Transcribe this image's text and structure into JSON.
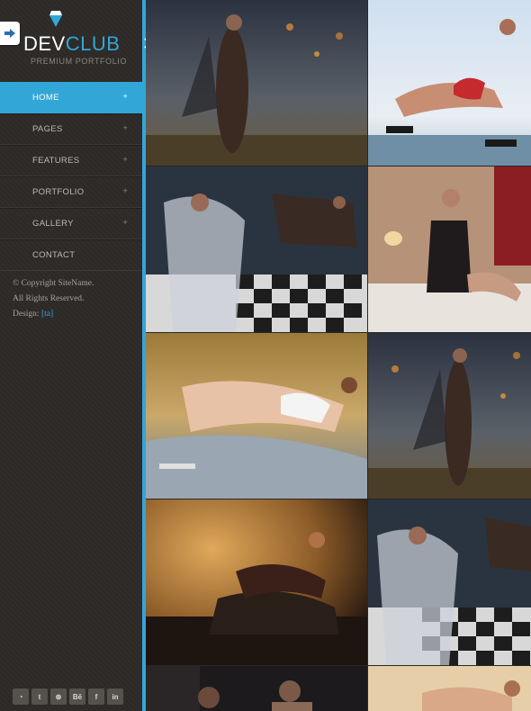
{
  "brand": {
    "title_part1": "DEV",
    "title_part2": "CLUB",
    "subtitle": "PREMIUM PORTFOLIO"
  },
  "nav": {
    "items": [
      {
        "label": "HOME",
        "has_sub": true
      },
      {
        "label": "PAGES",
        "has_sub": true
      },
      {
        "label": "FEATURES",
        "has_sub": true
      },
      {
        "label": "PORTFOLIO",
        "has_sub": true
      },
      {
        "label": "GALLERY",
        "has_sub": true
      },
      {
        "label": "CONTACT",
        "has_sub": false
      }
    ],
    "active": "HOME",
    "expand_symbol": "+"
  },
  "footer": {
    "copyright": "© Copyright SiteName.",
    "rights": "All Rights Reserved.",
    "design_label": "Design:",
    "design_link": "[ta]"
  },
  "social": [
    {
      "icon": "rss-icon",
      "glyph": "◔"
    },
    {
      "icon": "twitter-icon",
      "glyph": "t"
    },
    {
      "icon": "dribbble-icon",
      "glyph": "⊛"
    },
    {
      "icon": "behance-icon",
      "glyph": "Bē"
    },
    {
      "icon": "facebook-icon",
      "glyph": "f"
    },
    {
      "icon": "linkedin-icon",
      "glyph": "in"
    }
  ],
  "colors": {
    "accent": "#33a6d8",
    "sidebar_bg": "#2d2a28"
  },
  "gallery": [
    {
      "id": "stormy-field-model",
      "tone": "storm"
    },
    {
      "id": "red-swimsuit-beach",
      "tone": "sky"
    },
    {
      "id": "veil-piano-room",
      "tone": "piano"
    },
    {
      "id": "lace-bedroom",
      "tone": "bedroom"
    },
    {
      "id": "white-bikini-car",
      "tone": "golden"
    },
    {
      "id": "stormy-field-model-2",
      "tone": "storm"
    },
    {
      "id": "leather-sofa-amber",
      "tone": "amber"
    },
    {
      "id": "veil-piano-room-2",
      "tone": "piano"
    },
    {
      "id": "dark-couple",
      "tone": "dark"
    },
    {
      "id": "sand-beach",
      "tone": "sand"
    }
  ]
}
